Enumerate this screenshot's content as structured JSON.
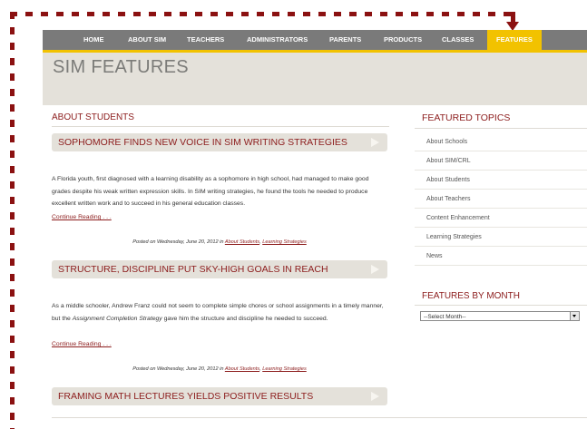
{
  "nav": {
    "items": [
      "HOME",
      "ABOUT SIM",
      "TEACHERS",
      "ADMINISTRATORS",
      "PARENTS",
      "PRODUCTS",
      "CLASSES",
      "FEATURES"
    ],
    "active": "FEATURES"
  },
  "banner": {
    "title": "SIM FEATURES"
  },
  "main": {
    "heading": "ABOUT STUDENTS",
    "posts": [
      {
        "title": "SOPHOMORE FINDS NEW VOICE IN SIM WRITING STRATEGIES",
        "excerpt": "A Florida youth, first diagnosed with a learning disability as a sophomore in high school, had managed to make good grades despite his weak written expression skills. In SIM writing strategies, he found the tools he needed to produce excellent written work and to succeed in his general education classes.",
        "more": "Continue Reading . . .",
        "meta_prefix": "Posted on Wednesday, June 20, 2012 in",
        "cat1": "About Students",
        "sep": ",",
        "cat2": "Learning Strategies"
      },
      {
        "title": "STRUCTURE, DISCIPLINE PUT SKY-HIGH GOALS IN REACH",
        "excerpt_a": "As a middle schooler, Andrew Franz could not seem to complete simple chores or school assignments in a timely manner, but the",
        "excerpt_em": "Assignment Completion Strategy",
        "excerpt_b": "gave him the structure and discipline he needed to succeed.",
        "more": "Continue Reading . . .",
        "meta_prefix": "Posted on Wednesday, June 20, 2012 in",
        "cat1": "About Students",
        "sep": ",",
        "cat2": "Learning Strategies"
      },
      {
        "title": "FRAMING MATH LECTURES YIELDS POSITIVE RESULTS"
      }
    ]
  },
  "sidebar": {
    "topics_heading": "FEATURED TOPICS",
    "topics": [
      "About Schools",
      "About SIM/CRL",
      "About Students",
      "About Teachers",
      "Content Enhancement",
      "Learning Strategies",
      "News"
    ],
    "month_heading": "FEATURES BY MONTH",
    "month_select": "--Select Month--"
  },
  "colors": {
    "accent": "#8c1c1c",
    "nav": "#7a7a7a",
    "highlight": "#f2c200",
    "panel": "#e4e1da",
    "annotation": "#8b1111"
  }
}
